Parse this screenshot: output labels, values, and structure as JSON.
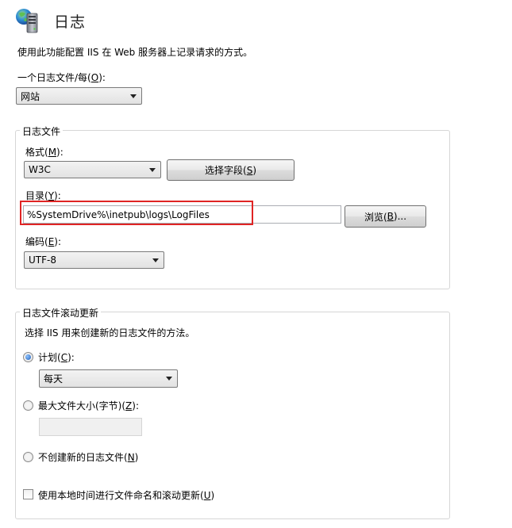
{
  "header": {
    "icon": "iis-logging-icon",
    "title": "日志"
  },
  "description": "使用此功能配置 IIS 在 Web 服务器上记录请求的方式。",
  "log_per": {
    "label_prefix": "一个日志文件/每(",
    "label_key": "O",
    "label_suffix": "):",
    "value": "网站"
  },
  "log_file_group": {
    "title": "日志文件",
    "format": {
      "label_prefix": "格式(",
      "label_key": "M",
      "label_suffix": "):",
      "value": "W3C"
    },
    "select_fields_button": {
      "prefix": "选择字段(",
      "key": "S",
      "suffix": ")"
    },
    "directory": {
      "label_prefix": "目录(",
      "label_key": "Y",
      "label_suffix": "):",
      "value": "%SystemDrive%\\inetpub\\logs\\LogFiles"
    },
    "browse_button": {
      "prefix": "浏览(",
      "key": "B",
      "suffix": ")..."
    },
    "encoding": {
      "label_prefix": "编码(",
      "label_key": "E",
      "label_suffix": "):",
      "value": "UTF-8"
    }
  },
  "rollover_group": {
    "title": "日志文件滚动更新",
    "description": "选择 IIS 用来创建新的日志文件的方法。",
    "schedule": {
      "label_prefix": "计划(",
      "label_key": "C",
      "label_suffix": "):",
      "selected": true,
      "value": "每天"
    },
    "max_size": {
      "label_prefix": "最大文件大小(字节)(",
      "label_key": "Z",
      "label_suffix": "):",
      "selected": false,
      "value": ""
    },
    "no_new": {
      "label_prefix": "不创建新的日志文件(",
      "label_key": "N",
      "label_suffix": ")",
      "selected": false
    },
    "local_time": {
      "label_prefix": "使用本地时间进行文件命名和滚动更新(",
      "label_key": "U",
      "label_suffix": ")",
      "checked": false
    }
  },
  "colors": {
    "highlight": "#e02424",
    "title": "#1e1e1e"
  }
}
